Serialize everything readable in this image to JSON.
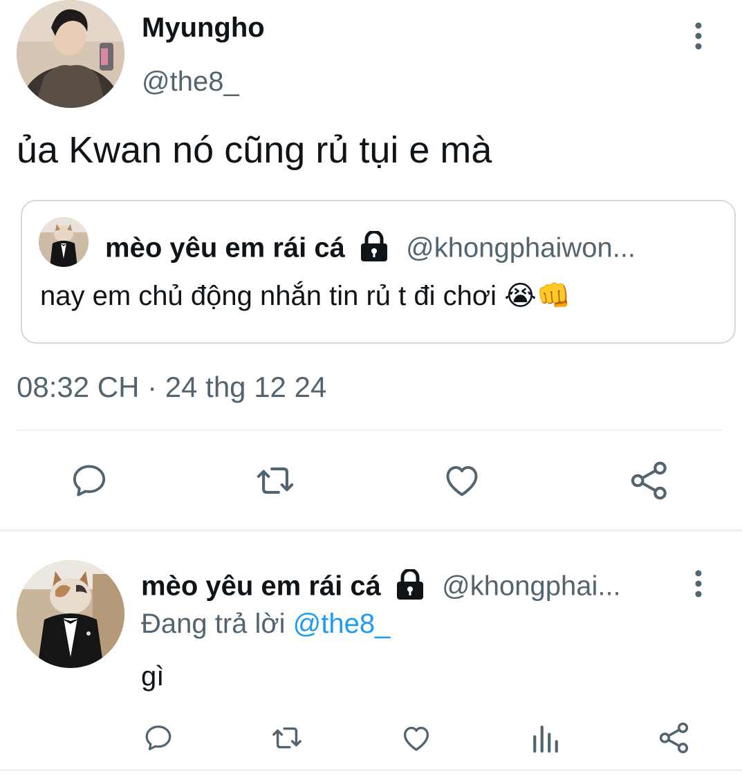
{
  "main_tweet": {
    "author_name": "Myungho",
    "author_handle": "@the8_",
    "text": "ủa Kwan nó cũng rủ tụi e mà",
    "quoted": {
      "author_name": "mèo yêu em rái cá",
      "author_handle": "@khongphaiwon...",
      "text": "nay em chủ động nhắn tin rủ t đi chơi 😭👊"
    },
    "timestamp": "08:32 CH · 24 thg 12 24"
  },
  "reply_tweet": {
    "author_name": "mèo yêu em rái cá",
    "author_handle": "@khongphai...",
    "replying_prefix": "Đang trả lời",
    "replying_to": "@the8_",
    "text": "gì"
  },
  "colors": {
    "text": "#0f1419",
    "muted": "#536471",
    "link": "#1d9bf0",
    "divider": "#eff3f4",
    "border": "#cfd9de"
  },
  "icons": [
    "more-icon",
    "reply-icon",
    "retweet-icon",
    "like-icon",
    "share-icon",
    "views-icon",
    "lock-icon"
  ]
}
